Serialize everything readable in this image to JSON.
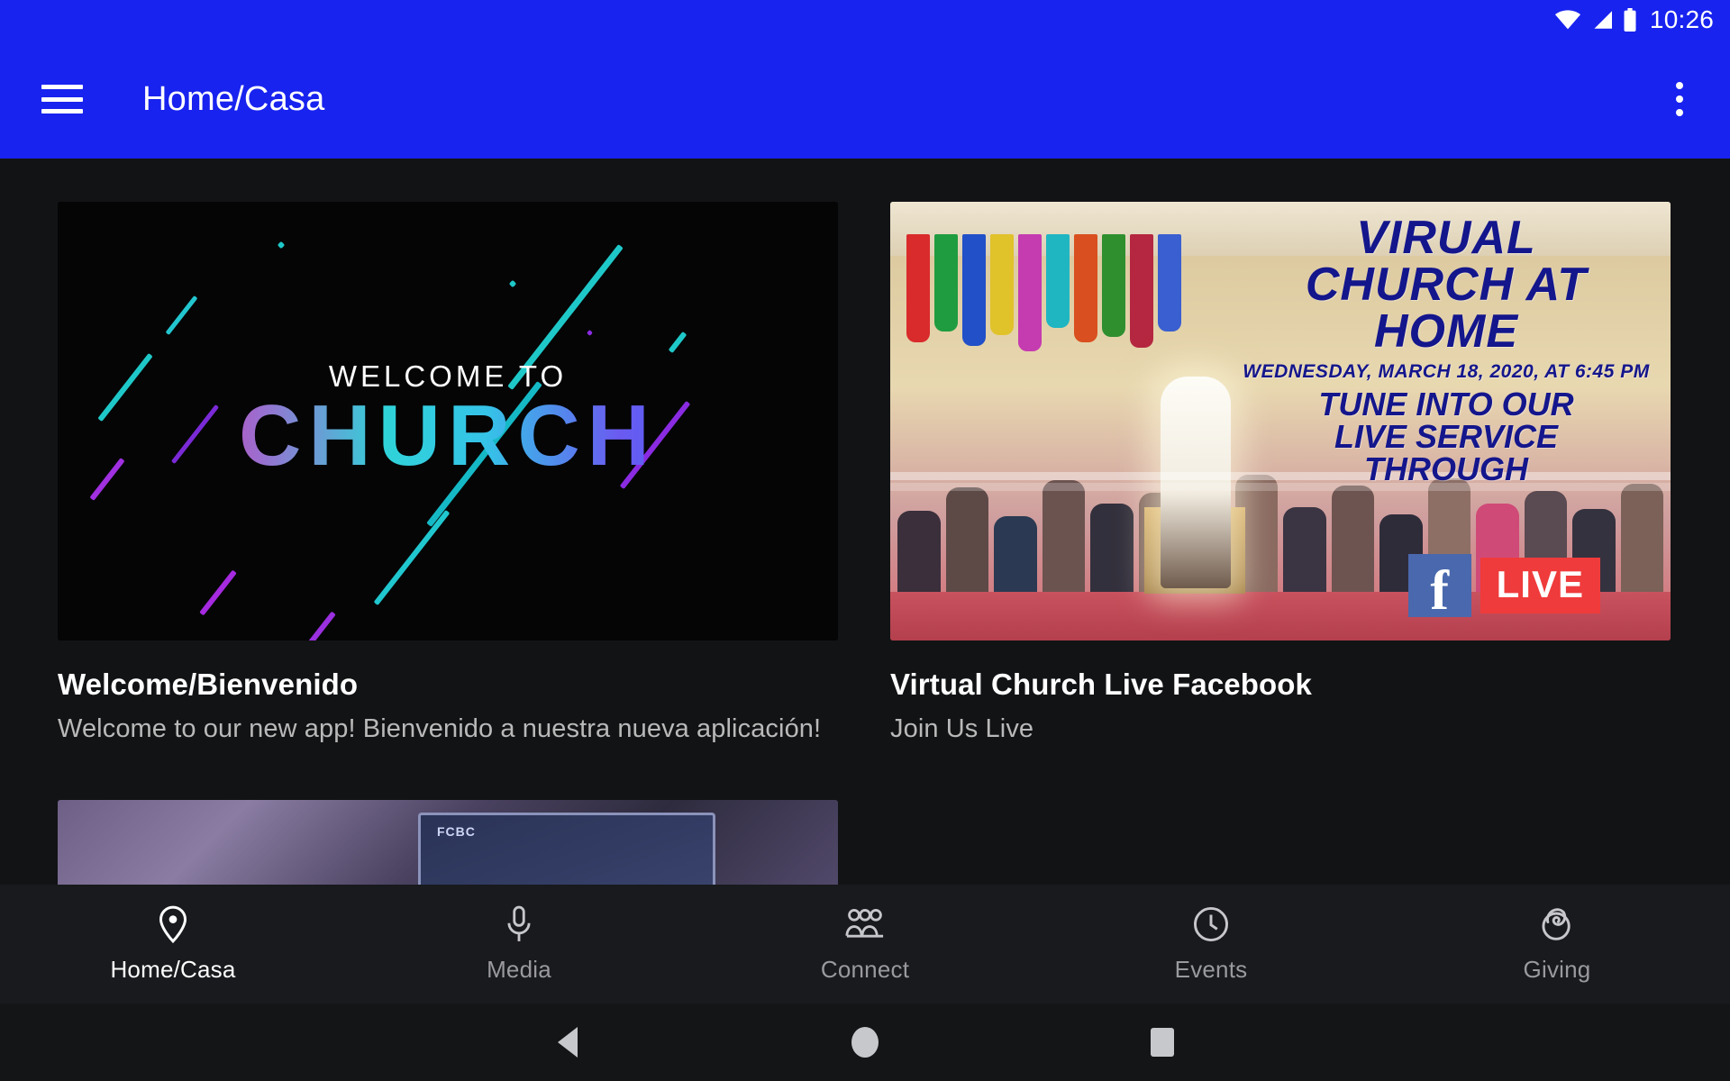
{
  "status_bar": {
    "time": "10:26",
    "icons": [
      "wifi-icon",
      "cellular-signal-icon",
      "battery-icon"
    ]
  },
  "app_bar": {
    "menu_icon": "hamburger-menu-icon",
    "title": "Home/Casa",
    "overflow_icon": "more-vertical-icon",
    "background_color": "#1823ef"
  },
  "cards": [
    {
      "title": "Welcome/Bienvenido",
      "subtitle": "Welcome to our new app! Bienvenido a nuestra nueva aplicación!",
      "image_alt": "welcome-to-church-banner",
      "image_text_top": "WELCOME TO",
      "image_text_main": "CHURCH"
    },
    {
      "title": "Virtual Church Live Facebook",
      "subtitle": "Join Us Live",
      "image_alt": "virtual-church-at-home-facebook-live-banner",
      "poster_line1": "VIRUAL",
      "poster_line2": "CHURCH AT",
      "poster_line3": "HOME",
      "poster_date": "WEDNESDAY, MARCH 18, 2020, AT 6:45 PM",
      "poster_line4": "TUNE INTO OUR",
      "poster_line5": "LIVE SERVICE",
      "poster_line6": "THROUGH",
      "badge_facebook": "f",
      "badge_live": "LIVE"
    }
  ],
  "partial_card": {
    "image_alt": "presentation-screen-thumbnail",
    "screen_label": "FCBC"
  },
  "bottom_nav": {
    "items": [
      {
        "label": "Home/Casa",
        "icon": "location-pin-icon",
        "active": true
      },
      {
        "label": "Media",
        "icon": "microphone-icon",
        "active": false
      },
      {
        "label": "Connect",
        "icon": "people-group-icon",
        "active": false
      },
      {
        "label": "Events",
        "icon": "clock-icon",
        "active": false
      },
      {
        "label": "Giving",
        "icon": "giving-hand-icon",
        "active": false
      }
    ]
  },
  "system_nav": {
    "back": "back-triangle-icon",
    "home": "home-circle-icon",
    "recents": "recents-square-icon"
  },
  "colors": {
    "brand_blue": "#1823ef",
    "page_background": "#121315",
    "tabbar_background": "#181a1d",
    "primary_text": "#ffffff",
    "secondary_text": "#b9b9b9",
    "inactive_tab": "#9a9a9e"
  }
}
